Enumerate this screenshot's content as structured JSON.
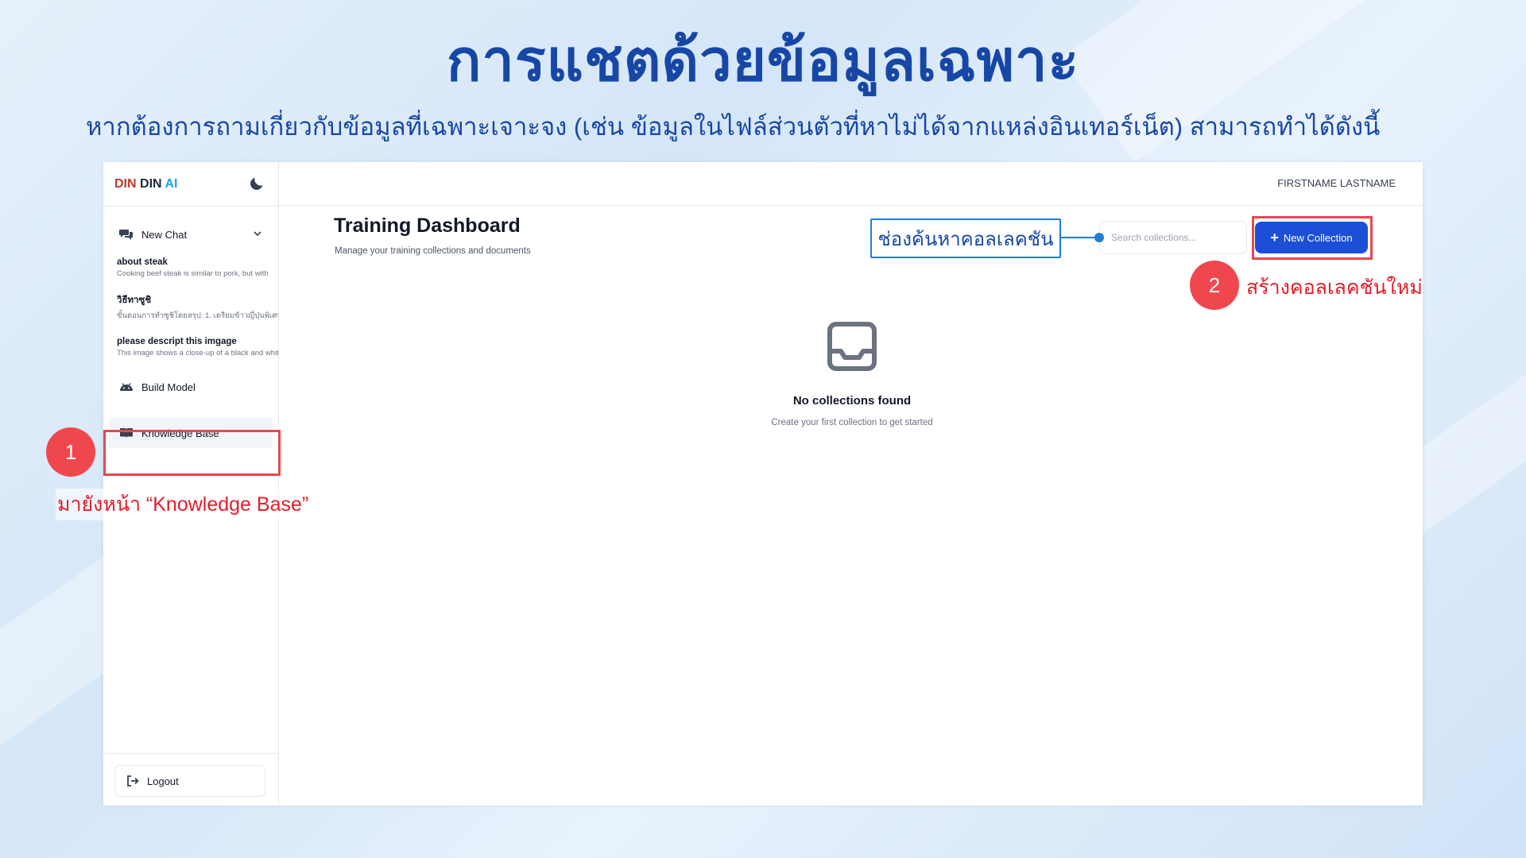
{
  "slide": {
    "title": "การแชตด้วยข้อมูลเฉพาะ",
    "subtitle": "หากต้องการถามเกี่ยวกับข้อมูลที่เฉพาะเจาะจง (เช่น ข้อมูลในไฟล์ส่วนตัวที่หาไม่ได้จากแหล่งอินเทอร์เน็ต) สามารถทำได้ดังนี้"
  },
  "brand": {
    "part1": "DIN",
    "part2": "DIN",
    "part3": "AI"
  },
  "sidebar": {
    "new_chat_label": "New Chat",
    "chats": [
      {
        "title": "about steak",
        "preview": "Cooking beef steak is similar to pork, but with"
      },
      {
        "title": "วิธีทาซูชิ",
        "preview": "ขั้นตอนการทำซูชิโดยสรุป: 1. เตรียมข้าวญี่ปุ่นพิเศษ"
      },
      {
        "title": "please descript this imgage",
        "preview": "This image shows a close-up of a black and white"
      }
    ],
    "build_model_label": "Build Model",
    "knowledge_base_label": "Knowledge Base",
    "logout_label": "Logout"
  },
  "topbar": {
    "user_name": "FIRSTNAME LASTNAME"
  },
  "dashboard": {
    "title": "Training Dashboard",
    "subtitle": "Manage your training collections and documents",
    "search_placeholder": "Search collections...",
    "new_collection_label": "New Collection",
    "empty_title": "No collections found",
    "empty_subtitle": "Create your first collection to get started"
  },
  "annotations": {
    "step1_number": "1",
    "step1_text": "มายังหน้า “Knowledge Base”",
    "step2_number": "2",
    "step2_text": "สร้างคอลเลคชันใหม่",
    "search_callout": "ช่องค้นหาคอลเลคชัน"
  },
  "colors": {
    "title_blue": "#1747a6",
    "primary_button": "#1d4ed8",
    "annotation_red": "#e21d2a",
    "badge_red": "#f0474f",
    "callout_blue": "#1f7fd6"
  },
  "icons": [
    "moon-icon",
    "chat-icon",
    "chevron-down-icon",
    "android-icon",
    "book-icon",
    "logout-icon",
    "plus-icon",
    "inbox-icon"
  ]
}
